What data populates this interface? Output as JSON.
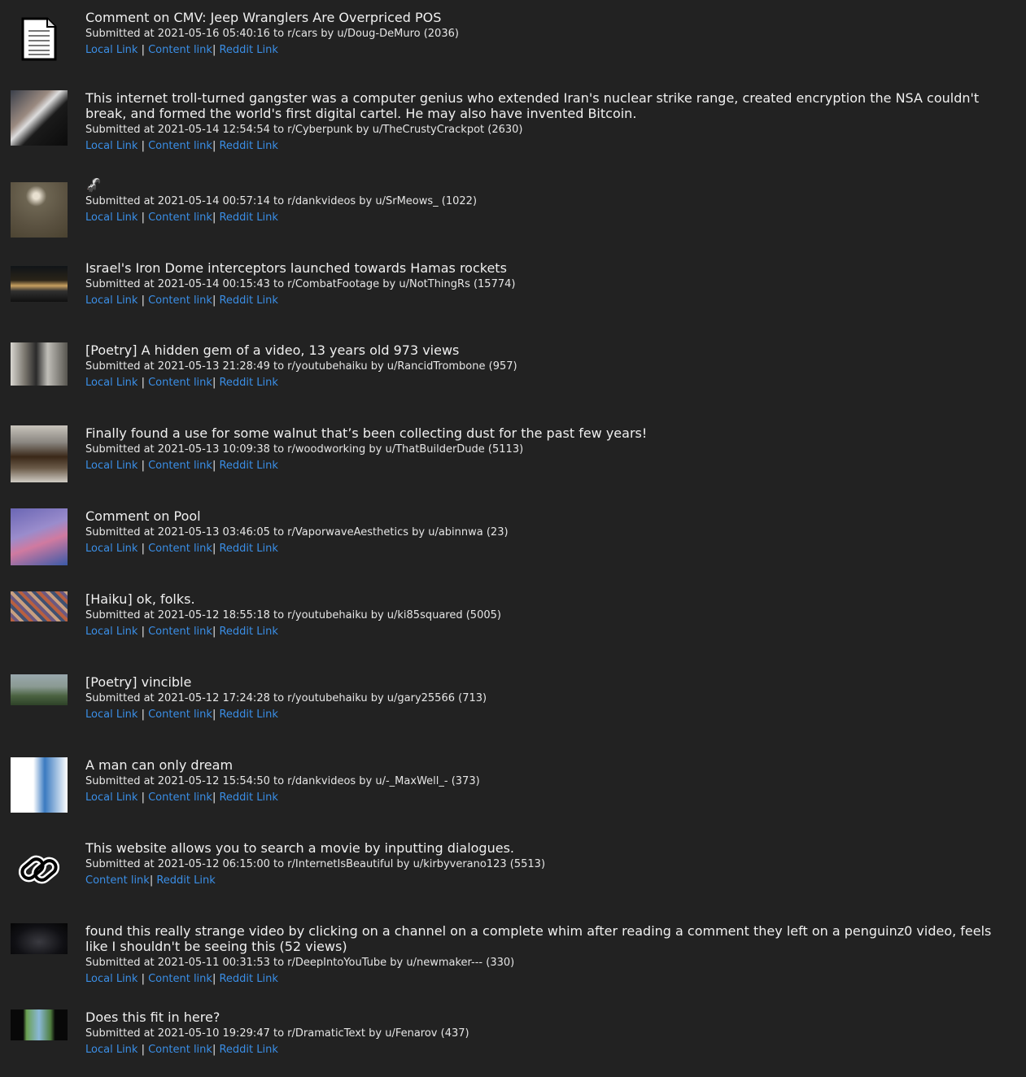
{
  "posts": [
    {
      "title": "Comment on CMV: Jeep Wranglers Are Overpriced POS",
      "submitted_at": "2021-05-16 05:40:16",
      "subreddit": "r/cars",
      "author": "u/Doug-DeMuro",
      "score": "(2036)",
      "thumb_icon": "document-icon",
      "links": [
        "Local Link",
        "Content link",
        "Reddit Link"
      ]
    },
    {
      "title": "This internet troll-turned gangster was a computer genius who extended Iran's nuclear strike range, created encryption the NSA couldn't break, and formed the world's first digital cartel. He may also have invented Bitcoin.",
      "submitted_at": "2021-05-14 12:54:54",
      "subreddit": "r/Cyberpunk",
      "author": "u/TheCrustyCrackpot",
      "score": "(2630)",
      "thumb_icon": "video-thumbnail",
      "links": [
        "Local Link",
        "Content link",
        "Reddit Link"
      ]
    },
    {
      "title": "🦨",
      "submitted_at": "2021-05-14 00:57:14",
      "subreddit": "r/dankvideos",
      "author": "u/SrMeows_",
      "score": "(1022)",
      "thumb_icon": "video-thumbnail",
      "links": [
        "Local Link",
        "Content link",
        "Reddit Link"
      ]
    },
    {
      "title": "Israel's Iron Dome interceptors launched towards Hamas rockets",
      "submitted_at": "2021-05-14 00:15:43",
      "subreddit": "r/CombatFootage",
      "author": "u/NotThingRs",
      "score": "(15774)",
      "thumb_icon": "video-thumbnail",
      "links": [
        "Local Link",
        "Content link",
        "Reddit Link"
      ]
    },
    {
      "title": "[Poetry] A hidden gem of a video, 13 years old 973 views",
      "submitted_at": "2021-05-13 21:28:49",
      "subreddit": "r/youtubehaiku",
      "author": "u/RancidTrombone",
      "score": "(957)",
      "thumb_icon": "video-thumbnail",
      "links": [
        "Local Link",
        "Content link",
        "Reddit Link"
      ]
    },
    {
      "title": "Finally found a use for some walnut that’s been collecting dust for the past few years!",
      "submitted_at": "2021-05-13 10:09:38",
      "subreddit": "r/woodworking",
      "author": "u/ThatBuilderDude",
      "score": "(5113)",
      "thumb_icon": "image-thumbnail",
      "links": [
        "Local Link",
        "Content link",
        "Reddit Link"
      ]
    },
    {
      "title": "Comment on Pool",
      "submitted_at": "2021-05-13 03:46:05",
      "subreddit": "r/VaporwaveAesthetics",
      "author": "u/abinnwa",
      "score": "(23)",
      "thumb_icon": "image-thumbnail",
      "links": [
        "Local Link",
        "Content link",
        "Reddit Link"
      ]
    },
    {
      "title": "[Haiku] ok, folks.",
      "submitted_at": "2021-05-12 18:55:18",
      "subreddit": "r/youtubehaiku",
      "author": "u/ki85squared",
      "score": "(5005)",
      "thumb_icon": "video-thumbnail",
      "links": [
        "Local Link",
        "Content link",
        "Reddit Link"
      ]
    },
    {
      "title": "[Poetry] vincible",
      "submitted_at": "2021-05-12 17:24:28",
      "subreddit": "r/youtubehaiku",
      "author": "u/gary25566",
      "score": "(713)",
      "thumb_icon": "video-thumbnail",
      "links": [
        "Local Link",
        "Content link",
        "Reddit Link"
      ]
    },
    {
      "title": "A man can only dream",
      "submitted_at": "2021-05-12 15:54:50",
      "subreddit": "r/dankvideos",
      "author": "u/-_MaxWell_-",
      "score": "(373)",
      "thumb_icon": "image-thumbnail",
      "links": [
        "Local Link",
        "Content link",
        "Reddit Link"
      ]
    },
    {
      "title": "This website allows you to search a movie by inputting dialogues.",
      "submitted_at": "2021-05-12 06:15:00",
      "subreddit": "r/InternetIsBeautiful",
      "author": "u/kirbyverano123",
      "score": "(5513)",
      "thumb_icon": "link-icon",
      "links": [
        "Content link",
        "Reddit Link"
      ]
    },
    {
      "title": "found this really strange video by clicking on a channel on a complete whim after reading a comment they left on a penguinz0 video, feels like I shouldn't be seeing this (52 views)",
      "submitted_at": "2021-05-11 00:31:53",
      "subreddit": "r/DeepIntoYouTube",
      "author": "u/newmaker---",
      "score": "(330)",
      "thumb_icon": "video-thumbnail",
      "links": [
        "Local Link",
        "Content link",
        "Reddit Link"
      ]
    },
    {
      "title": "Does this fit in here?",
      "submitted_at": "2021-05-10 19:29:47",
      "subreddit": "r/DramaticText",
      "author": "u/Fenarov",
      "score": "(437)",
      "thumb_icon": "video-thumbnail",
      "links": [
        "Local Link",
        "Content link",
        "Reddit Link"
      ]
    }
  ],
  "labels": {
    "submitted_prefix": "Submitted at",
    "to_word": "to",
    "by_word": "by",
    "link_sep": "|"
  },
  "colors": {
    "background": "#222222",
    "link": "#3a8ee6",
    "text": "#e8e8e8"
  }
}
